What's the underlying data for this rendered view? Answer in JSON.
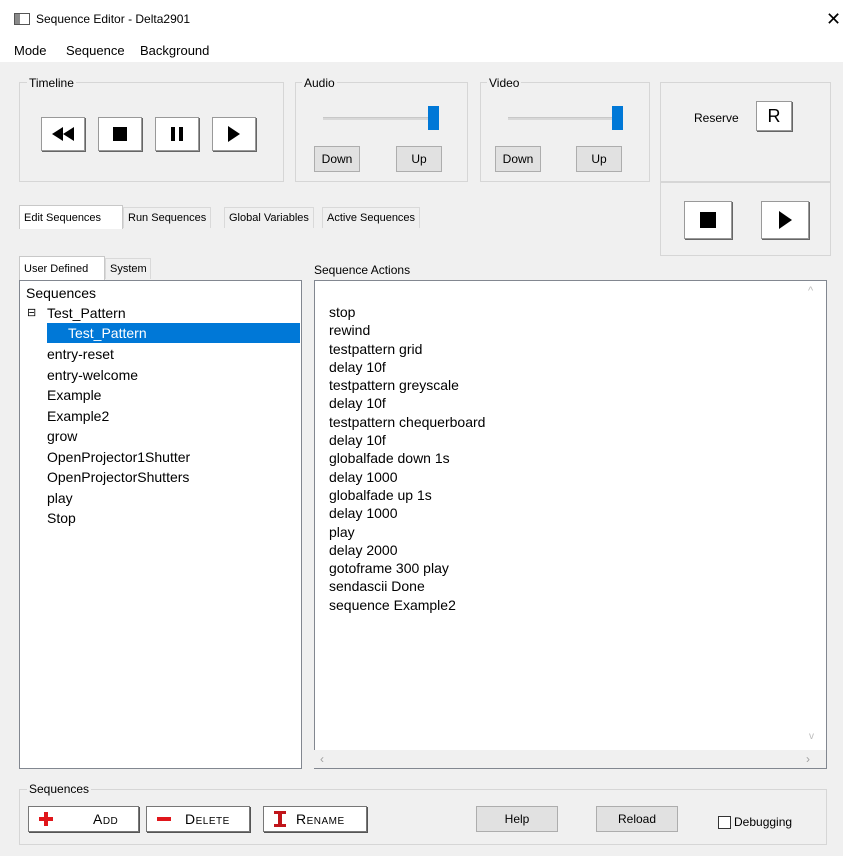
{
  "window": {
    "title": "Sequence Editor - Delta2901",
    "close_glyph": "✕"
  },
  "menu": {
    "items": [
      "Mode",
      "Sequence",
      "Background"
    ]
  },
  "timeline": {
    "label": "Timeline",
    "buttons": [
      "rewind-icon",
      "stop-icon",
      "pause-icon",
      "play-icon"
    ]
  },
  "audio": {
    "label": "Audio",
    "level": 0.95,
    "down_label": "Down",
    "up_label": "Up"
  },
  "video": {
    "label": "Video",
    "level": 0.95,
    "down_label": "Down",
    "up_label": "Up"
  },
  "reserve": {
    "label": "Reserve",
    "button_label": "R",
    "buttons": [
      "stop-icon",
      "play-icon"
    ]
  },
  "main_tabs": [
    "Edit Sequences",
    "Run Sequences",
    "Global Variables",
    "Active Sequences"
  ],
  "sub_tabs": [
    "User Defined",
    "System"
  ],
  "tree": {
    "root": "Sequences",
    "expander": "⊟",
    "items": [
      {
        "label": "Test_Pattern"
      },
      {
        "label": "Test_Pattern"
      },
      {
        "label": "entry-reset"
      },
      {
        "label": "entry-welcome"
      },
      {
        "label": "Example"
      },
      {
        "label": "Example2"
      },
      {
        "label": "grow"
      },
      {
        "label": "OpenProjector1Shutter"
      },
      {
        "label": "OpenProjectorShutters"
      },
      {
        "label": "play"
      },
      {
        "label": "Stop"
      }
    ]
  },
  "actions": {
    "label": "Sequence Actions",
    "lines": [
      "stop",
      "rewind",
      "testpattern grid",
      "delay 10f",
      "testpattern greyscale",
      "delay 10f",
      "testpattern chequerboard",
      "delay 10f",
      "globalfade down 1s",
      "delay 1000",
      "globalfade up 1s",
      "delay 1000",
      "play",
      "delay 2000",
      "gotoframe 300 play",
      "sendascii Done",
      "sequence Example2"
    ]
  },
  "footer": {
    "label": "Sequences",
    "add_label": "Add",
    "delete_label": "Delete",
    "rename_label": "Rename",
    "help_label": "Help",
    "reload_label": "Reload",
    "debugging_label": "Debugging",
    "debugging_checked": false
  },
  "colors": {
    "accent": "#0078d7",
    "selection": "#0078d7",
    "add_red": "#e0161b",
    "rename_red": "#c0151a"
  }
}
